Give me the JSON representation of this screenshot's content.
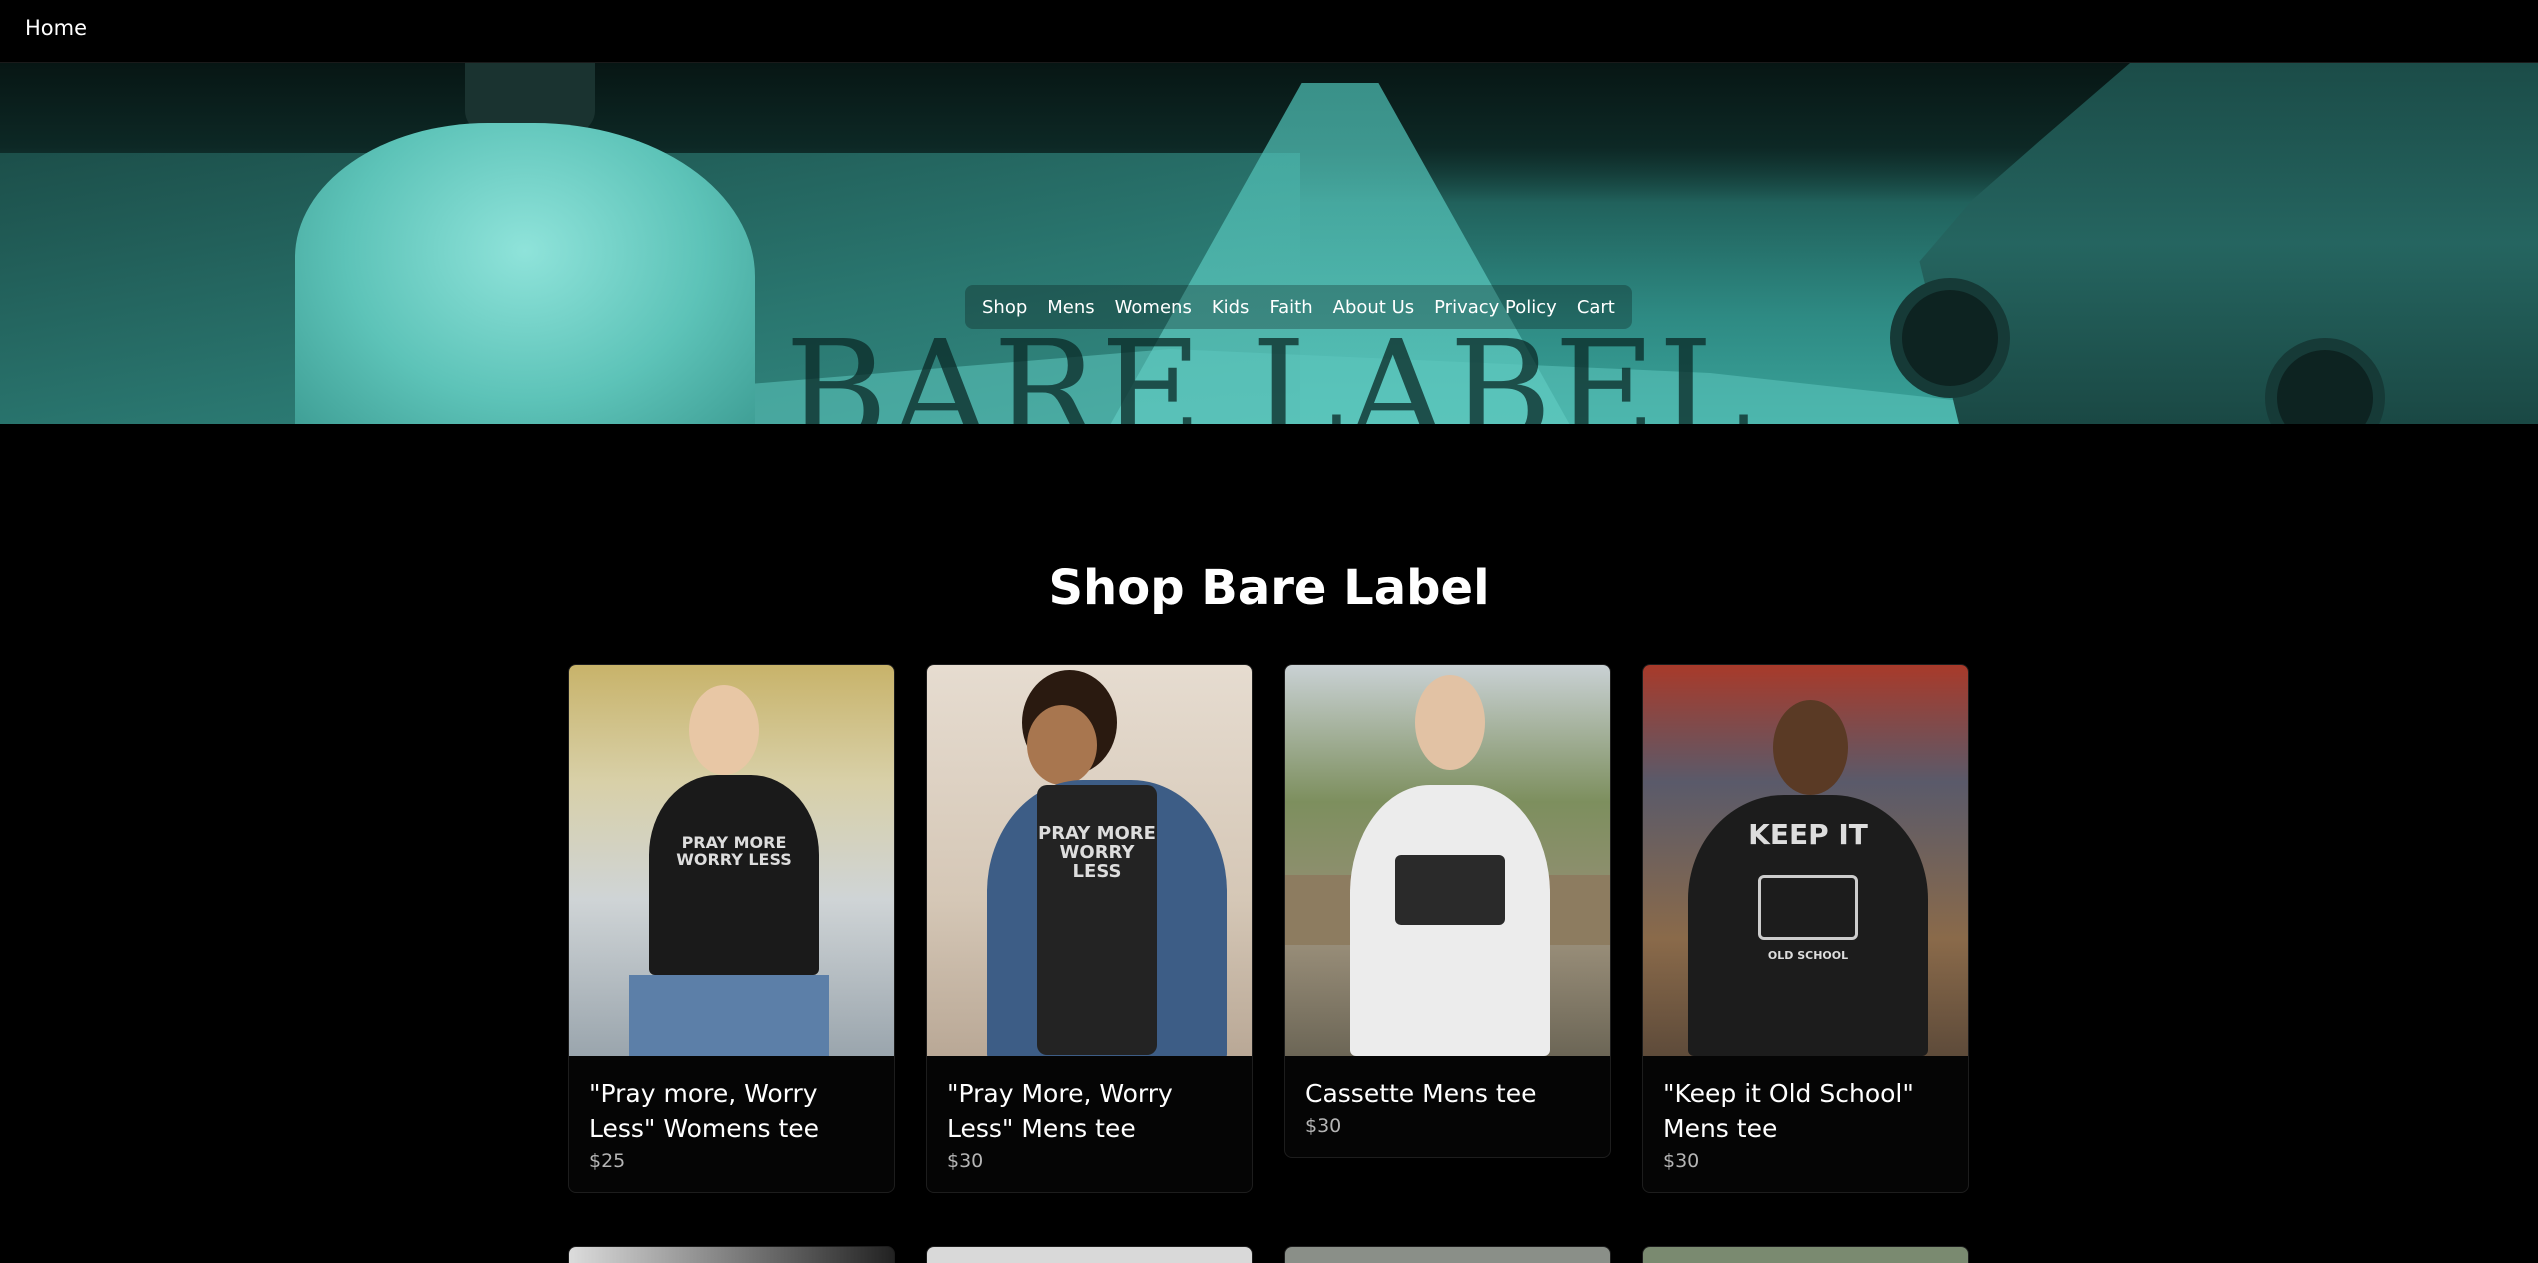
{
  "topbar": {
    "home_label": "Home"
  },
  "hero": {
    "nav": [
      "Shop",
      "Mens",
      "Womens",
      "Kids",
      "Faith",
      "About Us",
      "Privacy Policy",
      "Cart"
    ],
    "brand": "BARE LABEL"
  },
  "section": {
    "title": "Shop Bare Label"
  },
  "products": [
    {
      "title": "\"Pray more, Worry Less\" Womens tee",
      "price": "$25",
      "shirt_text": "PRAY MORE WORRY LESS"
    },
    {
      "title": "\"Pray More, Worry Less\" Mens tee",
      "price": "$30",
      "shirt_text": "PRAY MORE WORRY LESS"
    },
    {
      "title": "Cassette Mens tee",
      "price": "$30"
    },
    {
      "title": "\"Keep it Old School\" Mens tee",
      "price": "$30",
      "shirt_text": "KEEP IT",
      "shirt_subtext": "OLD SCHOOL"
    }
  ],
  "colors": {
    "background": "#000000",
    "hero_tint": "#2e8a83",
    "price": "#b5b5b5"
  }
}
